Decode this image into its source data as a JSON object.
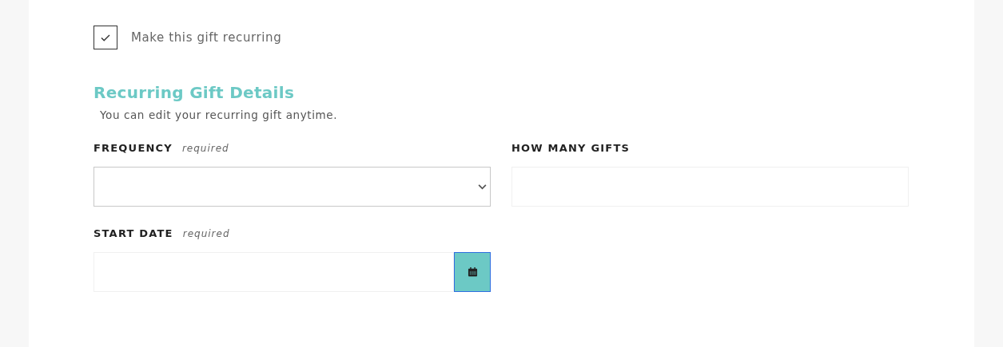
{
  "recurring_checkbox": {
    "label": "Make this gift recurring",
    "checked": true
  },
  "section": {
    "title": "Recurring Gift Details",
    "subtitle": "You can edit your recurring gift anytime."
  },
  "fields": [
    {
      "kind": "select",
      "label": "FREQUENCY",
      "hint": "required"
    },
    {
      "kind": "text",
      "label": "HOW MANY GIFTS"
    },
    {
      "kind": "date",
      "label": "START DATE",
      "hint": "required"
    }
  ]
}
